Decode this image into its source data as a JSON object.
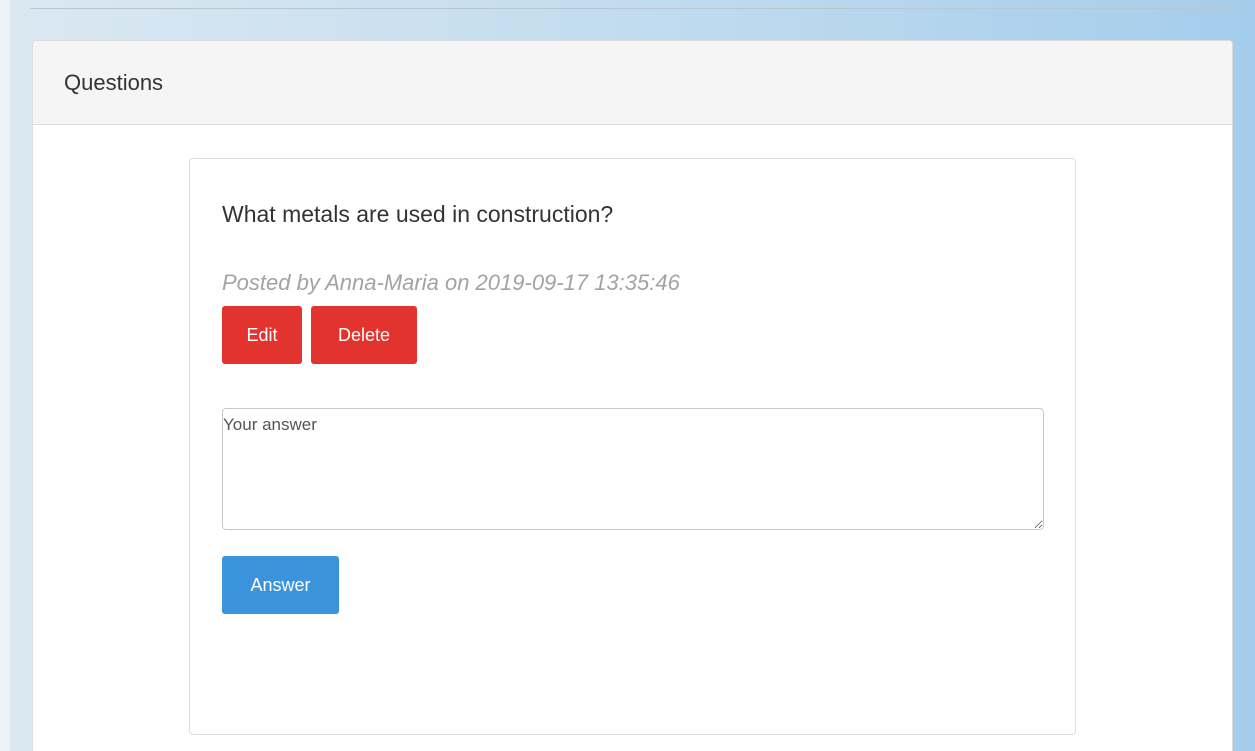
{
  "panel": {
    "title": "Questions"
  },
  "question": {
    "text": "What metals are used in construction?",
    "posted_by": "Posted by Anna-Maria on 2019-09-17 13:35:46",
    "edit_label": "Edit",
    "delete_label": "Delete"
  },
  "answer_form": {
    "placeholder": "Your answer",
    "value": "",
    "submit_label": "Answer"
  },
  "colors": {
    "danger": "#e3332f",
    "primary": "#3a93db"
  }
}
